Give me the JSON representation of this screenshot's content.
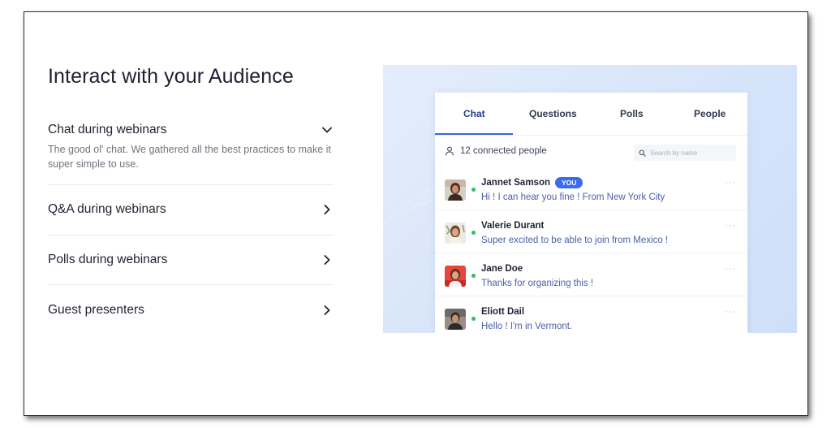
{
  "title": "Interact with your Audience",
  "accordion": [
    {
      "title": "Chat during webinars",
      "description": "The good ol' chat. We gathered all the best practices to make it super simple to use.",
      "expanded": true
    },
    {
      "title": "Q&A during webinars",
      "expanded": false
    },
    {
      "title": "Polls during webinars",
      "expanded": false
    },
    {
      "title": "Guest presenters",
      "expanded": false
    }
  ],
  "panel": {
    "tabs": [
      "Chat",
      "Questions",
      "Polls",
      "People"
    ],
    "active_tab": "Chat",
    "connected": "12 connected people",
    "search_placeholder": "Search by name",
    "messages": [
      {
        "name": "Jannet Samson",
        "badge": "YOU",
        "text": "Hi ! I can hear you fine ! From New York City",
        "more": "···"
      },
      {
        "name": "Valerie Durant",
        "text": "Super excited to be able to join from Mexico !",
        "more": "···"
      },
      {
        "name": "Jane Doe",
        "text": "Thanks for organizing this !",
        "more": "···"
      },
      {
        "name": "Eliott Dail",
        "text": "Hello ! I'm in Vermont.",
        "more": "···"
      }
    ]
  },
  "colors": {
    "accent": "#3366e6",
    "online": "#2fbf63",
    "panel_bg": "#d6e4fa",
    "message_text": "#4a5fa8"
  }
}
